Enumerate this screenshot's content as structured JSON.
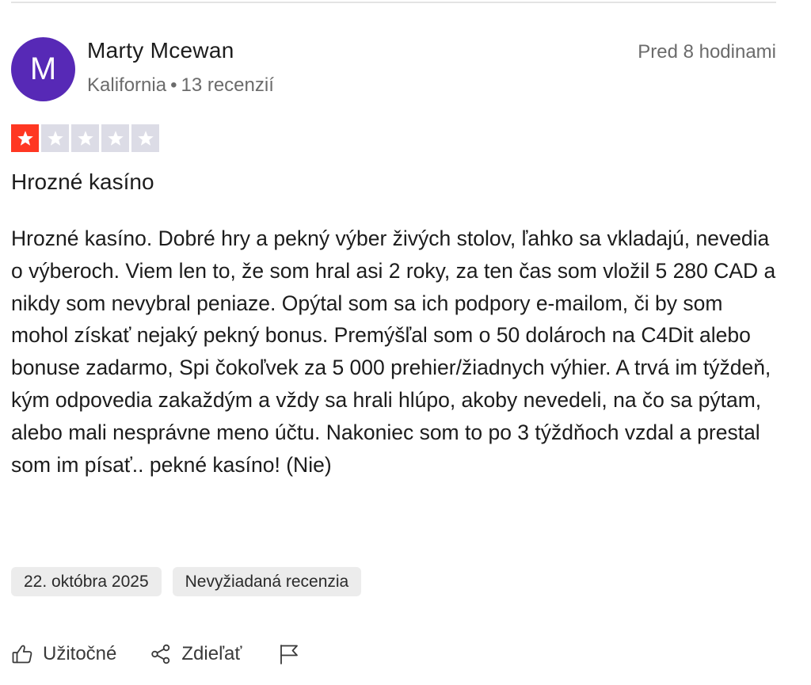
{
  "reviewer": {
    "initial": "M",
    "name": "Marty Mcewan",
    "location": "Kalifornia",
    "separator": "•",
    "review_count": "13 recenzií",
    "avatar_color": "#5729b6"
  },
  "review": {
    "time_ago": "Pred 8 hodinami",
    "rating": 1,
    "max_rating": 5,
    "star_filled_color": "#ff3722",
    "star_empty_color": "#dcdce6",
    "title": "Hrozné kasíno",
    "body": "Hrozné kasíno. Dobré hry a pekný výber živých stolov, ľahko sa vkladajú, nevedia o výberoch. Viem len to, že som hral asi 2 roky, za ten čas som vložil 5 280 CAD a nikdy som nevybral peniaze. Opýtal som sa ich podpory e-mailom, či by som mohol získať nejaký pekný bonus. Premýšľal som o 50 dolároch na C4Dit alebo bonuse zadarmo, Spi čokoľvek za 5 000 prehier/žiadnych výhier. A trvá im týždeň, kým odpovedia zakaždým a vždy sa hrali hlúpo, akoby nevedeli, na čo sa pýtam, alebo mali nesprávne meno účtu. Nakoniec som to po 3 týždňoch vzdal a prestal som im písať.. pekné kasíno! (Nie)",
    "date": "22. októbra 2025",
    "tag": "Nevyžiadaná recenzia"
  },
  "actions": {
    "helpful": {
      "label": "Užitočné",
      "icon": "thumbs-up-icon"
    },
    "share": {
      "label": "Zdieľať",
      "icon": "share-icon"
    },
    "report": {
      "icon": "flag-icon"
    }
  }
}
